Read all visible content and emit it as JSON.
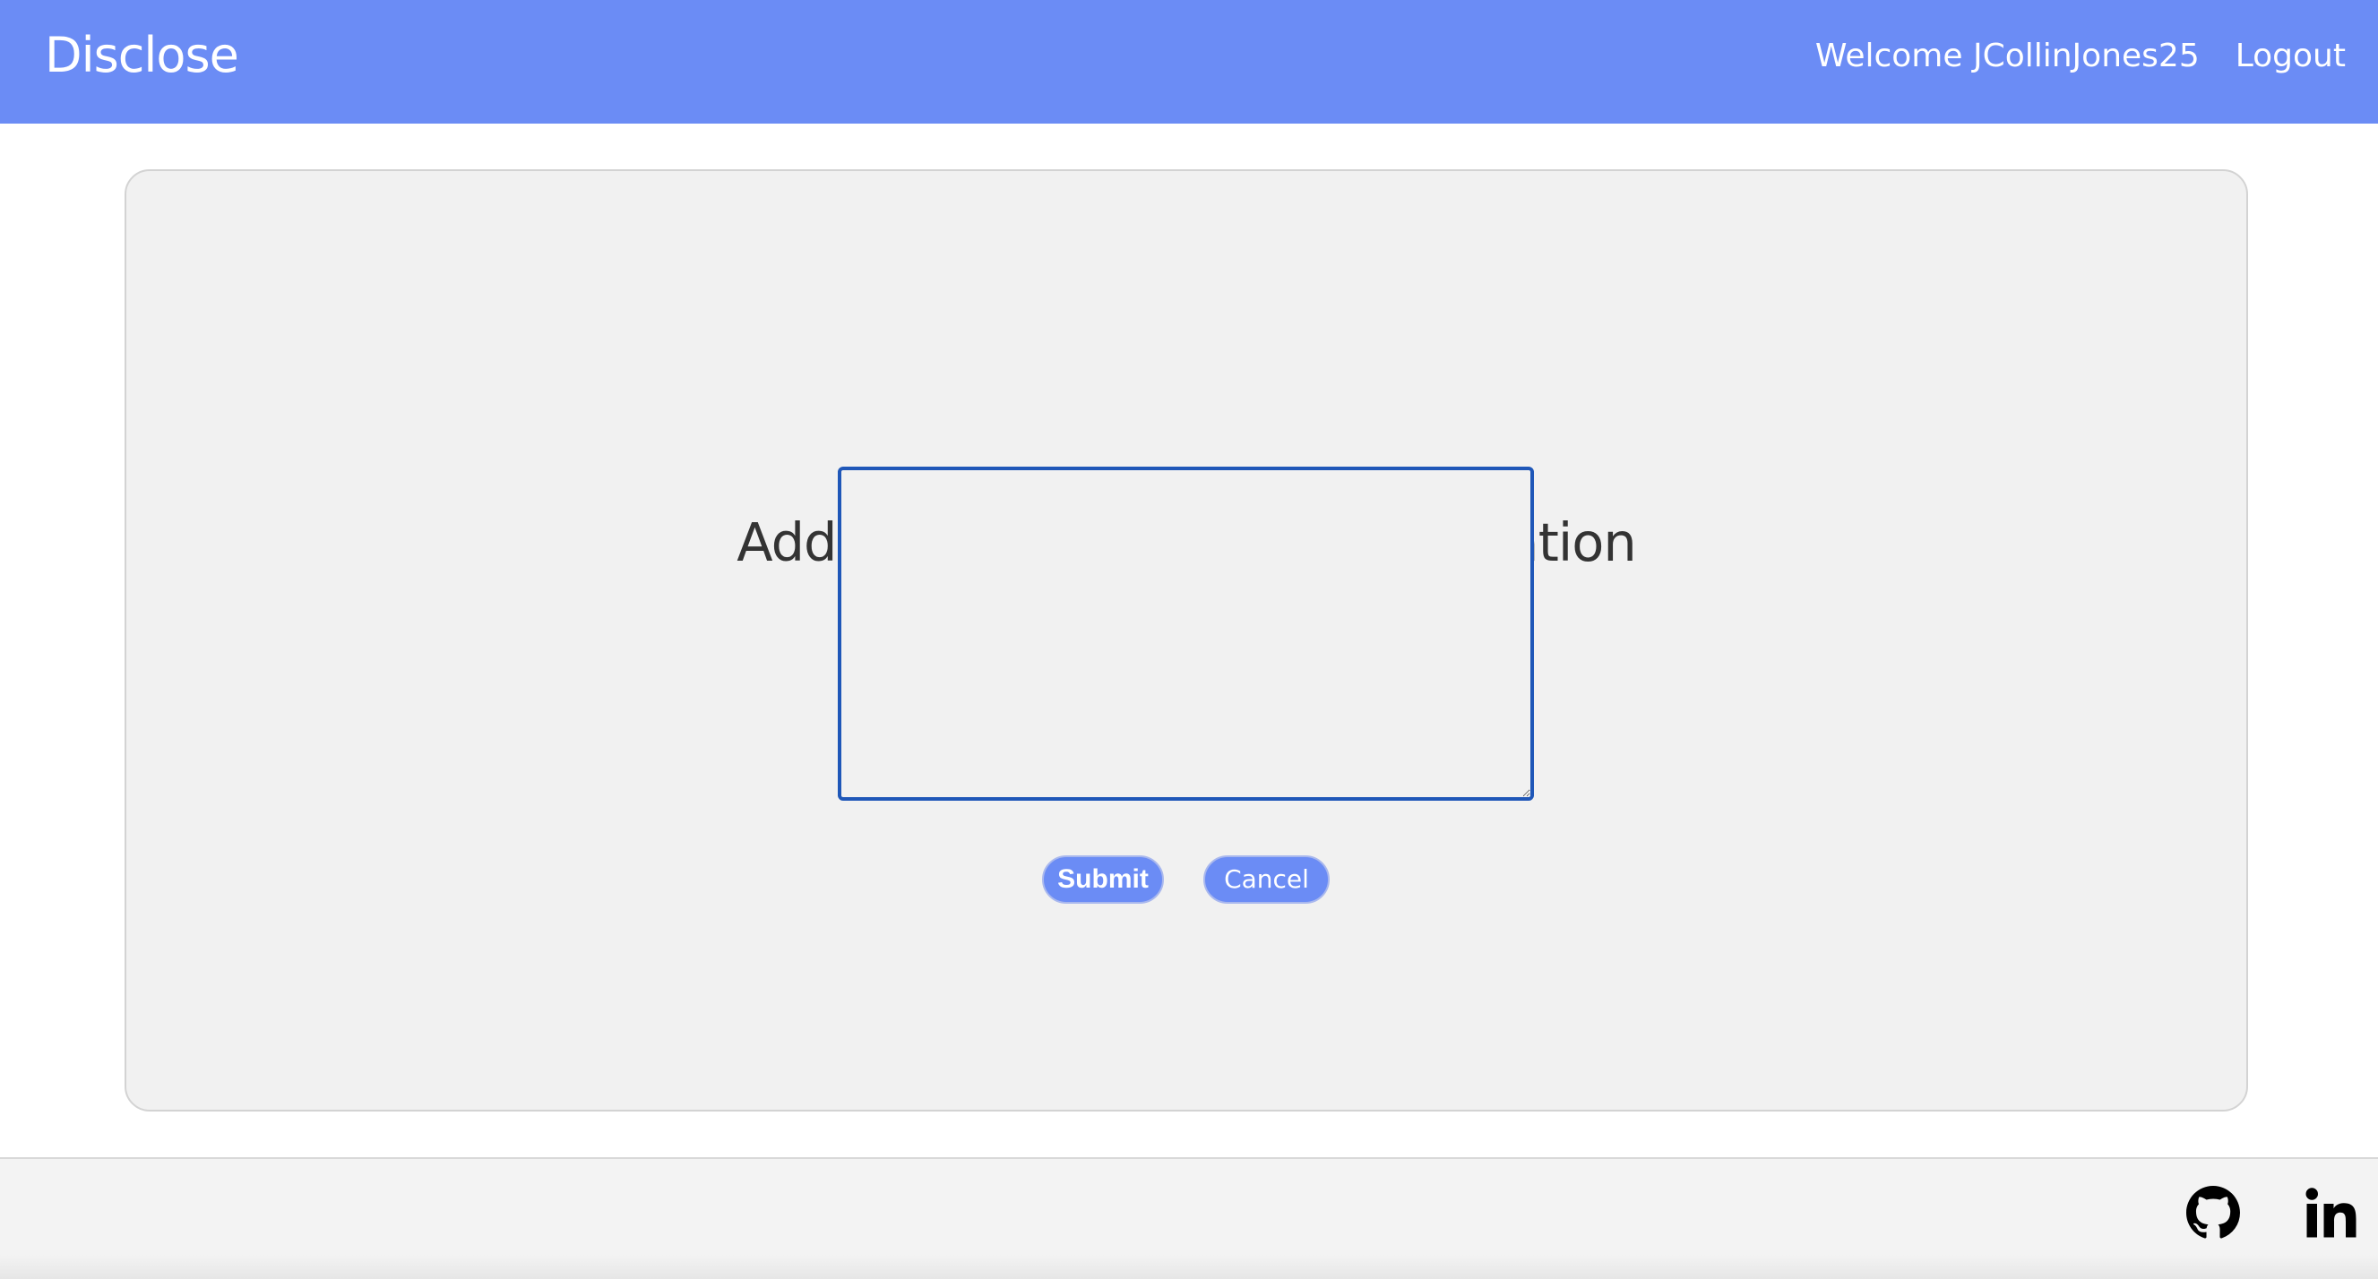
{
  "navbar": {
    "brand": "Disclose",
    "welcome": "Welcome JCollinJones25",
    "logout": "Logout",
    "color": "#6b8cf5"
  },
  "main": {
    "heading": "Add a comment about this location",
    "comment_value": "",
    "submit_label": "Submit",
    "cancel_label": "Cancel"
  },
  "footer": {
    "icons": [
      "github-icon",
      "linkedin-icon"
    ]
  }
}
